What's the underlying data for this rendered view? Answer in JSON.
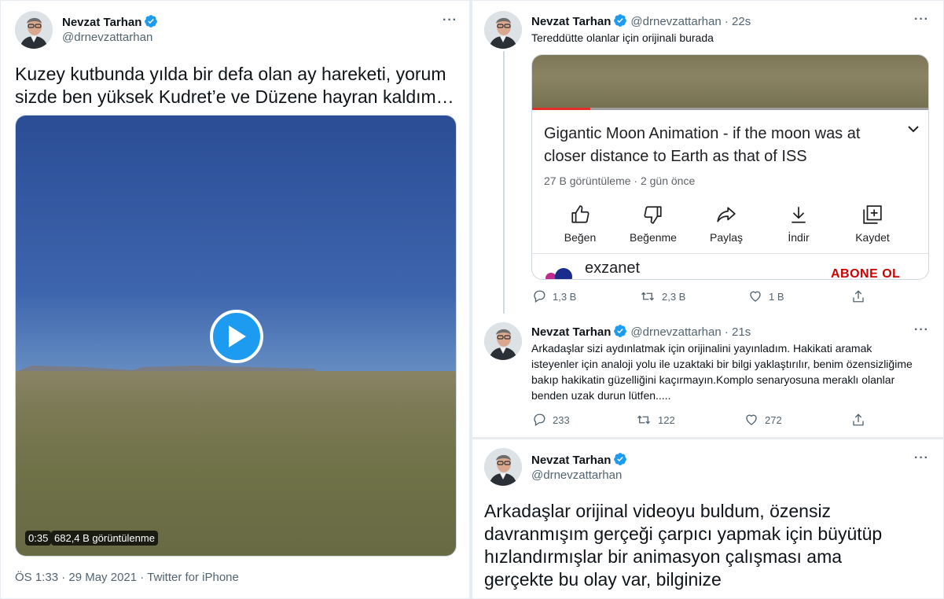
{
  "left_tweet": {
    "author_name": "Nevzat Tarhan",
    "handle": "@drnevzattarhan",
    "more": "···",
    "text": "Kuzey kutbunda yılda bir defa olan ay hareketi, yorum sizde ben yüksek Kudret’e ve Düzene hayran kaldım…",
    "video": {
      "duration": "0:35",
      "views": "682,4 B görüntülenme"
    },
    "meta": "ÖS 1:33 · 29 May 2021 · Twitter for iPhone"
  },
  "reply1": {
    "author_name": "Nevzat Tarhan",
    "handle": "@drnevzattarhan",
    "time": "· 22s",
    "more": "···",
    "text": "Tereddütte olanlar için orijinali burada",
    "card": {
      "title": "Gigantic Moon Animation - if the moon was at closer distance to Earth as that of ISS",
      "views": "27 B görüntüleme · 2 gün önce",
      "actions": [
        "Beğen",
        "Beğenme",
        "Paylaş",
        "İndir",
        "Kaydet"
      ],
      "channel": "exzanet",
      "subscribe": "ABONE OL"
    },
    "stats": {
      "replies": "1,3 B",
      "retweets": "2,3 B",
      "likes": "1 B"
    }
  },
  "reply2": {
    "author_name": "Nevzat Tarhan",
    "handle": "@drnevzattarhan",
    "time": "· 21s",
    "more": "···",
    "text": "Arkadaşlar sizi aydınlatmak için orijinalini yayınladım. Hakikati aramak isteyenler için analoji yolu ile uzaktaki bir bilgi yaklaştırılır, benim özensizliğime bakıp hakikatin güzelliğini kaçırmayın.Komplo senaryosuna meraklı olanlar benden uzak durun lütfen.....",
    "stats": {
      "replies": "233",
      "retweets": "122",
      "likes": "272"
    }
  },
  "bottom_tweet": {
    "author_name": "Nevzat Tarhan",
    "handle": "@drnevzattarhan",
    "more": "···",
    "text": "Arkadaşlar orijinal videoyu buldum, özensiz davranmışım gerçeği çarpıcı yapmak için büyütüp hızlandırmışlar bir animasyon çalışması ama gerçekte bu olay var, bilginize"
  },
  "colors": {
    "accent": "#1d9bf0",
    "muted": "#536471",
    "youtube_red": "#cc0000"
  }
}
